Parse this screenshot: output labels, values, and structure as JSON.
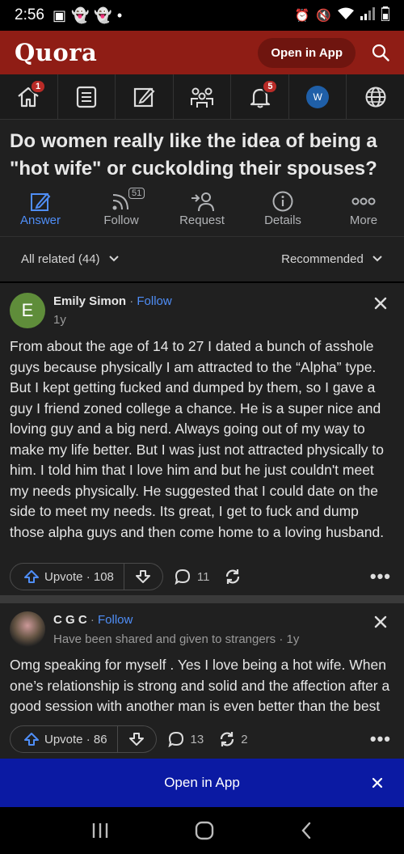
{
  "status_bar": {
    "time": "2:56"
  },
  "topbar": {
    "logo": "Quora",
    "open_app": "Open in App"
  },
  "nav": {
    "home_badge": "1",
    "notifications_badge": "5",
    "avatar_letter": "W"
  },
  "question": {
    "title": "Do women really like the idea of being a \"hot wife\" or cuckolding their spouses?",
    "actions": [
      {
        "label": "Answer",
        "icon": "pencil-icon"
      },
      {
        "label": "Follow",
        "icon": "rss-icon",
        "count": "51"
      },
      {
        "label": "Request",
        "icon": "add-person-icon"
      },
      {
        "label": "Details",
        "icon": "info-icon"
      },
      {
        "label": "More",
        "icon": "more-icon"
      }
    ]
  },
  "filter": {
    "related": "All related (44)",
    "sort": "Recommended"
  },
  "answers": [
    {
      "avatar_letter": "E",
      "author": "Emily Simon",
      "follow": "Follow",
      "time": "1y",
      "text": "From about the age of 14 to 27 I dated a bunch of asshole guys because physically I am attracted to the “Alpha” type. But I kept getting fucked and dumped by them, so I gave a guy I friend zoned college a chance. He is a super nice and loving guy and a big nerd. Always going out of my way to make my life better. But I was just not attracted physically to him. I told him that I love him and but he just couldn't meet my needs physically. He suggested that I could date on the side to meet my needs. Its great, I get to fuck and dump those alpha guys and then come home to a loving husband.",
      "upvote_label": "Upvote · 108",
      "comments": "11",
      "shares": ""
    },
    {
      "author": "C G C",
      "follow": "Follow",
      "credential": "Have been shared and given to strangers · 1y",
      "text": "Omg speaking for myself . Yes I love being a hot wife. When one’s relationship is strong and solid and the affection after a good session with another man is even better than the best wait to admit addiction. The",
      "upvote_label": "Upvote · 86",
      "comments": "13",
      "shares": "2"
    }
  ],
  "footer": {
    "open_app": "Open in App"
  },
  "colors": {
    "brand": "#8f1d15",
    "banner": "#0b1aa3",
    "link": "#4f8ef7"
  }
}
